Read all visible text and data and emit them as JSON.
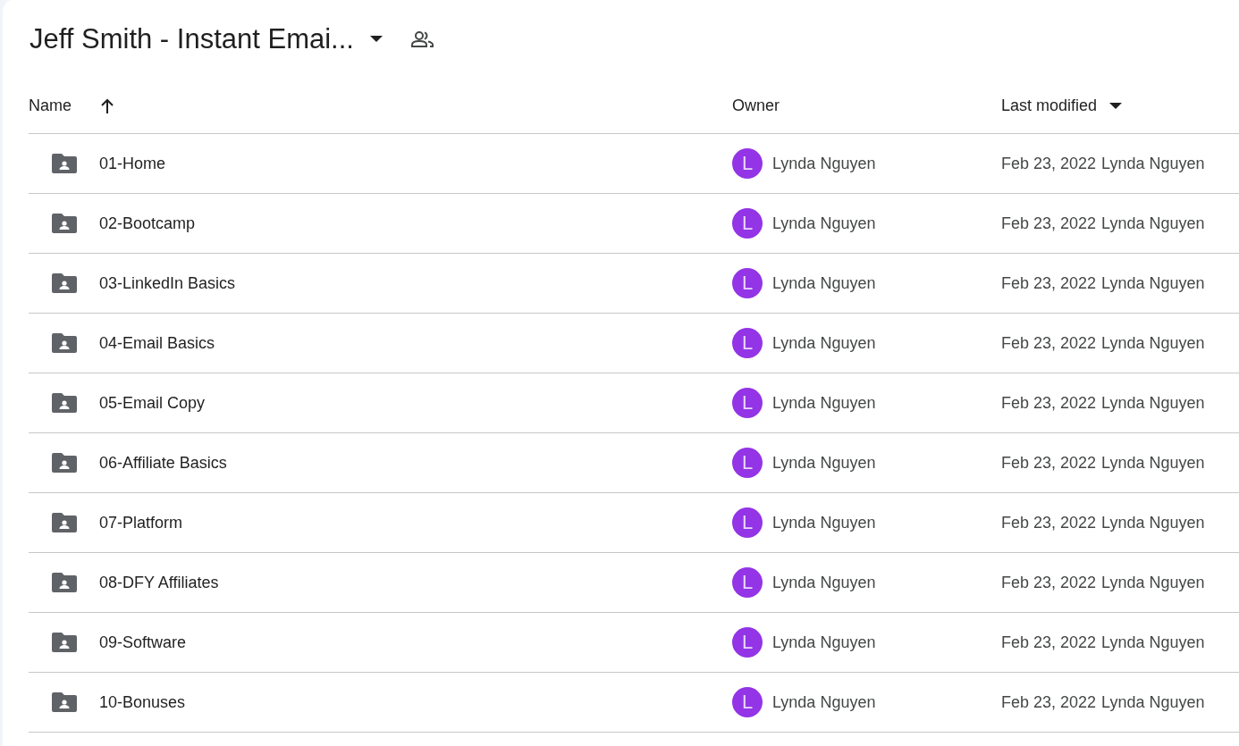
{
  "title": "Jeff Smith - Instant Emai...",
  "columns": [
    {
      "label": "Name",
      "sorted": true,
      "menu": false
    },
    {
      "label": "Owner",
      "sorted": false,
      "menu": false
    },
    {
      "label": "Last modified",
      "sorted": false,
      "menu": true
    }
  ],
  "rows": [
    {
      "name": "01-Home",
      "owner_initial": "L",
      "owner": "Lynda Nguyen",
      "modified_date": "Feb 23, 2022",
      "modified_by": "Lynda Nguyen"
    },
    {
      "name": "02-Bootcamp",
      "owner_initial": "L",
      "owner": "Lynda Nguyen",
      "modified_date": "Feb 23, 2022",
      "modified_by": "Lynda Nguyen"
    },
    {
      "name": "03-LinkedIn Basics",
      "owner_initial": "L",
      "owner": "Lynda Nguyen",
      "modified_date": "Feb 23, 2022",
      "modified_by": "Lynda Nguyen"
    },
    {
      "name": "04-Email Basics",
      "owner_initial": "L",
      "owner": "Lynda Nguyen",
      "modified_date": "Feb 23, 2022",
      "modified_by": "Lynda Nguyen"
    },
    {
      "name": "05-Email Copy",
      "owner_initial": "L",
      "owner": "Lynda Nguyen",
      "modified_date": "Feb 23, 2022",
      "modified_by": "Lynda Nguyen"
    },
    {
      "name": "06-Affiliate Basics",
      "owner_initial": "L",
      "owner": "Lynda Nguyen",
      "modified_date": "Feb 23, 2022",
      "modified_by": "Lynda Nguyen"
    },
    {
      "name": "07-Platform",
      "owner_initial": "L",
      "owner": "Lynda Nguyen",
      "modified_date": "Feb 23, 2022",
      "modified_by": "Lynda Nguyen"
    },
    {
      "name": "08-DFY Affiliates",
      "owner_initial": "L",
      "owner": "Lynda Nguyen",
      "modified_date": "Feb 23, 2022",
      "modified_by": "Lynda Nguyen"
    },
    {
      "name": "09-Software",
      "owner_initial": "L",
      "owner": "Lynda Nguyen",
      "modified_date": "Feb 23, 2022",
      "modified_by": "Lynda Nguyen"
    },
    {
      "name": "10-Bonuses",
      "owner_initial": "L",
      "owner": "Lynda Nguyen",
      "modified_date": "Feb 23, 2022",
      "modified_by": "Lynda Nguyen"
    }
  ]
}
